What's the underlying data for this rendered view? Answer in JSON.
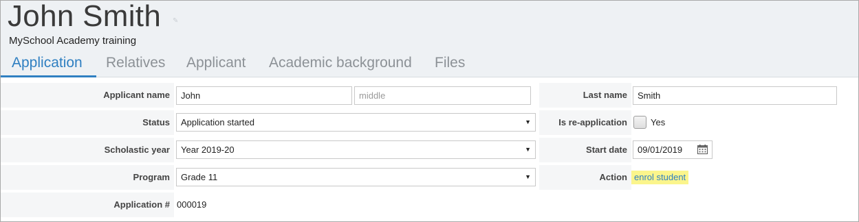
{
  "header": {
    "name": "John Smith",
    "subtitle": "MySchool Academy training"
  },
  "tabs": [
    {
      "label": "Application",
      "active": true
    },
    {
      "label": "Relatives"
    },
    {
      "label": "Applicant"
    },
    {
      "label": "Academic background"
    },
    {
      "label": "Files"
    }
  ],
  "form": {
    "applicant_name": {
      "label": "Applicant name",
      "first": "John",
      "middle_placeholder": "middle"
    },
    "last_name": {
      "label": "Last name",
      "value": "Smith"
    },
    "status": {
      "label": "Status",
      "value": "Application started"
    },
    "reapplication": {
      "label": "Is re-application",
      "option": "Yes",
      "checked": false
    },
    "scholastic_year": {
      "label": "Scholastic year",
      "value": "Year 2019-20"
    },
    "start_date": {
      "label": "Start date",
      "value": "09/01/2019"
    },
    "program": {
      "label": "Program",
      "value": "Grade 11"
    },
    "action": {
      "label": "Action",
      "value": "enrol student"
    },
    "application_number": {
      "label": "Application #",
      "value": "000019"
    }
  },
  "colors": {
    "accent": "#2f7fc1",
    "highlight": "#fbf58c",
    "header_bg": "#eef1f4"
  }
}
